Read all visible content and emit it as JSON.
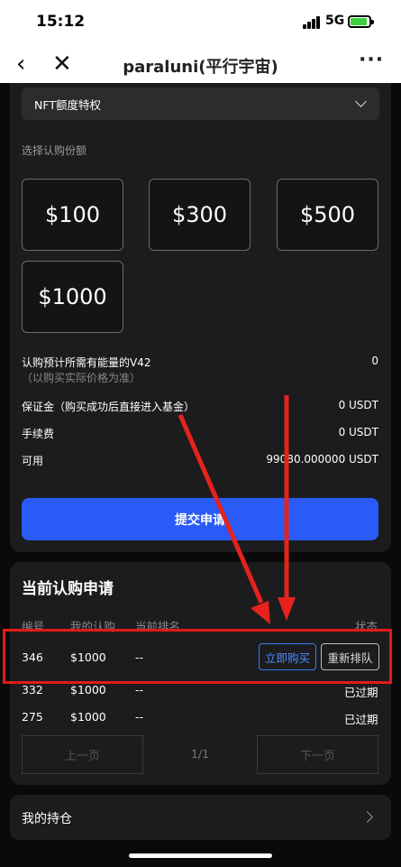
{
  "status_bar": {
    "time": "15:12",
    "network": "5G"
  },
  "nav": {
    "title": "paraluni(平行宇宙)",
    "back_icon": "‹",
    "close_icon": "✕",
    "more_icon": "···"
  },
  "privilege_select": {
    "label": "NFT额度特权"
  },
  "amounts": {
    "label": "选择认购份额",
    "options": [
      "$100",
      "$300",
      "$500",
      "$1000"
    ]
  },
  "info": {
    "energy_label": "认购预计所需有能量的V42",
    "energy_value": "0",
    "energy_note": "（以购买实际价格为准）",
    "deposit_label": "保证金（购买成功后直接进入基金）",
    "deposit_value": "0 USDT",
    "fee_label": "手续费",
    "fee_value": "0 USDT",
    "available_label": "可用",
    "available_value": "99080.000000 USDT"
  },
  "submit_label": "提交申请",
  "current_requests": {
    "title": "当前认购申请",
    "headers": [
      "编号",
      "我的认购",
      "当前排名",
      "状态"
    ],
    "rows": [
      {
        "id": "346",
        "amount": "$1000",
        "rank": "--",
        "buy_label": "立即购买",
        "requeue_label": "重新排队"
      },
      {
        "id": "332",
        "amount": "$1000",
        "rank": "--",
        "status": "已过期"
      },
      {
        "id": "275",
        "amount": "$1000",
        "rank": "--",
        "status": "已过期"
      }
    ],
    "pager": {
      "prev": "上一页",
      "indicator": "1/1",
      "next": "下一页"
    }
  },
  "holdings_label": "我的持仓",
  "colors": {
    "accent_blue": "#2a5bf6",
    "annotation_red": "#e11b17",
    "card_bg": "#1c1c1e"
  }
}
